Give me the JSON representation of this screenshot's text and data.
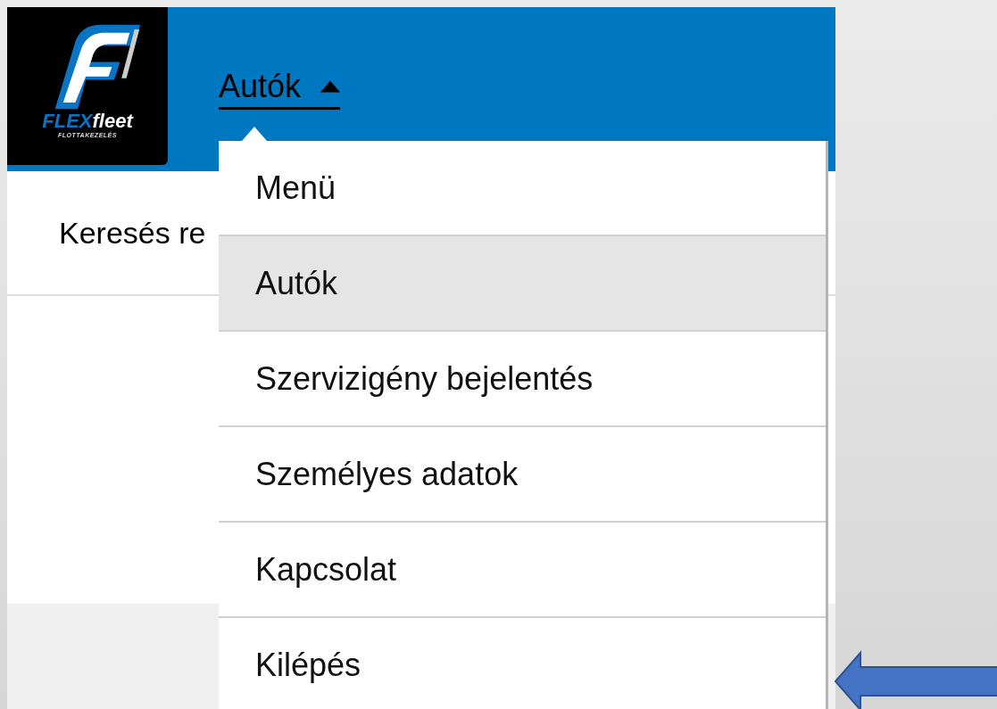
{
  "logo": {
    "brand_prefix": "FLEX",
    "brand_suffix": "fleet",
    "tagline": "FLOTTAKEZELÉS"
  },
  "nav": {
    "label": "Autók",
    "expanded": true
  },
  "search_heading": "Keresés re",
  "menu": [
    {
      "label": "Menü",
      "selected": false,
      "pointed_at": false
    },
    {
      "label": "Autók",
      "selected": true,
      "pointed_at": false
    },
    {
      "label": "Szervizigény bejelentés",
      "selected": false,
      "pointed_at": false
    },
    {
      "label": "Személyes adatok",
      "selected": false,
      "pointed_at": false
    },
    {
      "label": "Kapcsolat",
      "selected": false,
      "pointed_at": false
    },
    {
      "label": "Kilépés",
      "selected": false,
      "pointed_at": true
    }
  ]
}
